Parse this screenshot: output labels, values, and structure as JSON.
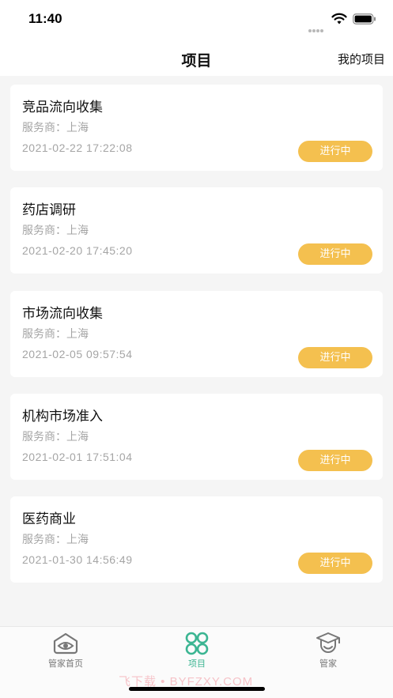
{
  "status_bar": {
    "time": "11:40"
  },
  "nav": {
    "title": "项目",
    "right_action": "我的项目"
  },
  "projects": [
    {
      "title": "竞品流向收集",
      "provider": "服务商：上海",
      "time": "2021-02-22 17:22:08",
      "status": "进行中"
    },
    {
      "title": "药店调研",
      "provider": "服务商：上海",
      "time": "2021-02-20 17:45:20",
      "status": "进行中"
    },
    {
      "title": "市场流向收集",
      "provider": "服务商：上海",
      "time": "2021-02-05 09:57:54",
      "status": "进行中"
    },
    {
      "title": "机构市场准入",
      "provider": "服务商：上海",
      "time": "2021-02-01 17:51:04",
      "status": "进行中"
    },
    {
      "title": "医药商业",
      "provider": "服务商：上海",
      "time": "2021-01-30 14:56:49",
      "status": "进行中"
    }
  ],
  "tabs": [
    {
      "label": "管家首页",
      "icon": "eye-house-icon",
      "active": false
    },
    {
      "label": "项目",
      "icon": "four-circles-icon",
      "active": true
    },
    {
      "label": "管家",
      "icon": "graduation-cap-face-icon",
      "active": false
    }
  ],
  "watermark": "飞下载 • BYFZXY.COM",
  "colors": {
    "accent": "#3bb592",
    "badge": "#f4c04f",
    "muted_text": "#a5a5a5",
    "background": "#f5f5f5"
  }
}
